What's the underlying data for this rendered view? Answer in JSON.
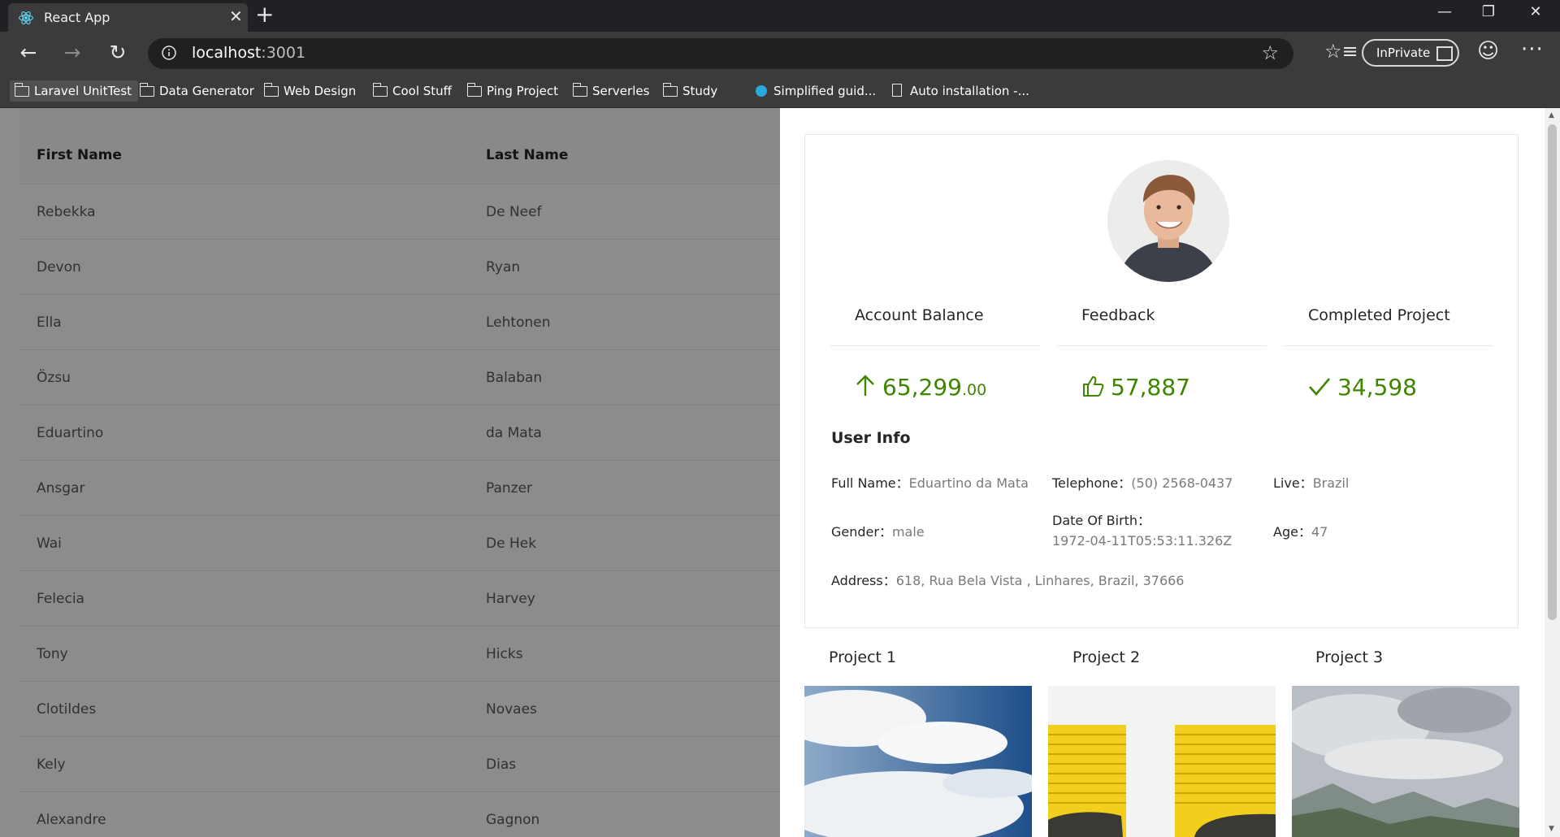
{
  "browser": {
    "tab_title": "React App",
    "url_host": "localhost",
    "url_port": ":3001",
    "inprivate_label": "InPrivate",
    "bookmarks": [
      {
        "label": "Laravel UnitTest",
        "icon": "folder-icon"
      },
      {
        "label": "Data Generator",
        "icon": "folder-icon"
      },
      {
        "label": "Web Design",
        "icon": "folder-icon"
      },
      {
        "label": "Cool Stuff",
        "icon": "folder-icon"
      },
      {
        "label": "Ping Project",
        "icon": "folder-icon"
      },
      {
        "label": "Serverles",
        "icon": "folder-icon"
      },
      {
        "label": "Study",
        "icon": "folder-icon"
      },
      {
        "label": "Simplified guid...",
        "icon": "site-favicon"
      },
      {
        "label": "Auto installation -...",
        "icon": "page-icon"
      }
    ]
  },
  "table": {
    "headers": [
      "First Name",
      "Last Name"
    ],
    "rows": [
      [
        "Rebekka",
        "De Neef"
      ],
      [
        "Devon",
        "Ryan"
      ],
      [
        "Ella",
        "Lehtonen"
      ],
      [
        "Özsu",
        "Balaban"
      ],
      [
        "Eduartino",
        "da Mata"
      ],
      [
        "Ansgar",
        "Panzer"
      ],
      [
        "Wai",
        "De Hek"
      ],
      [
        "Felecia",
        "Harvey"
      ],
      [
        "Tony",
        "Hicks"
      ],
      [
        "Clotildes",
        "Novaes"
      ],
      [
        "Kely",
        "Dias"
      ],
      [
        "Alexandre",
        "Gagnon"
      ]
    ]
  },
  "drawer": {
    "stats": [
      {
        "title": "Account Balance",
        "value": "65,299",
        "decimal": ".00",
        "icon": "arrow-up-icon"
      },
      {
        "title": "Feedback",
        "value": "57,887",
        "decimal": "",
        "icon": "thumbs-up-icon"
      },
      {
        "title": "Completed Project",
        "value": "34,598",
        "decimal": "",
        "icon": "check-icon"
      }
    ],
    "stat_color": "#3f8600",
    "user_info_title": "User Info",
    "fields": {
      "full_name": {
        "label": "Full Name：",
        "value": "Eduartino da Mata"
      },
      "telephone": {
        "label": "Telephone：",
        "value": "(50) 2568-0437"
      },
      "live": {
        "label": "Live：",
        "value": "Brazil"
      },
      "gender": {
        "label": "Gender：",
        "value": "male"
      },
      "dob": {
        "label": "Date Of Birth：",
        "value": "1972-04-11T05:53:11.326Z"
      },
      "age": {
        "label": "Age：",
        "value": "47"
      },
      "address": {
        "label": "Address：",
        "value": "618, Rua Bela Vista , Linhares, Brazil, 37666"
      }
    },
    "projects": [
      "Project 1",
      "Project 2",
      "Project 3"
    ]
  }
}
